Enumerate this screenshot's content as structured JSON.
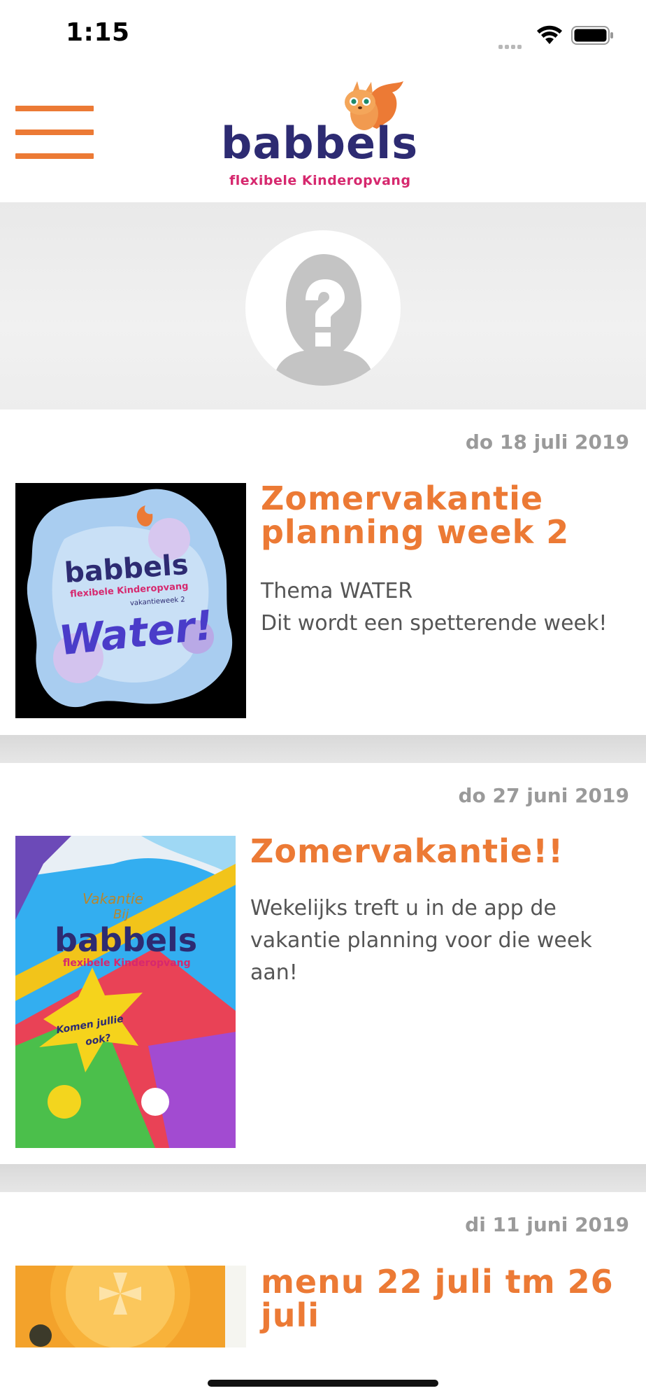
{
  "status": {
    "time": "1:15"
  },
  "header": {
    "logo_word": "babbels",
    "logo_subtitle": "flexibele Kinderopvang",
    "brand_color": "#ec7a35",
    "logo_color": "#2d2b72"
  },
  "profile": {
    "avatar_icon": "unknown-person-icon"
  },
  "news": [
    {
      "date": "do 18 juli 2019",
      "title_line1": "Zomervakantie",
      "title_line2": "planning week 2",
      "text_line1": "Thema WATER",
      "text_line2": "Dit wordt een spetterende week!",
      "thumb_logo": "babbels",
      "thumb_sub": "flexibele Kinderopvang",
      "thumb_sub2": "vakantieweek 2",
      "thumb_word": "Water!"
    },
    {
      "date": "do 27 juni 2019",
      "title_line1": "Zomervakantie!!",
      "text_line1": "Wekelijks treft u in de app de",
      "text_line2": "vakantie planning voor die week",
      "text_line3": "aan!",
      "thumb_top": "Vakantie",
      "thumb_top2": "Bij",
      "thumb_logo": "babbels",
      "thumb_sub": "flexibele Kinderopvang",
      "thumb_star": "Komen jullie",
      "thumb_star2": "ook?"
    },
    {
      "date": "di 11 juni 2019",
      "title_line1": "menu 22 juli tm 26",
      "title_line2": "juli"
    }
  ]
}
